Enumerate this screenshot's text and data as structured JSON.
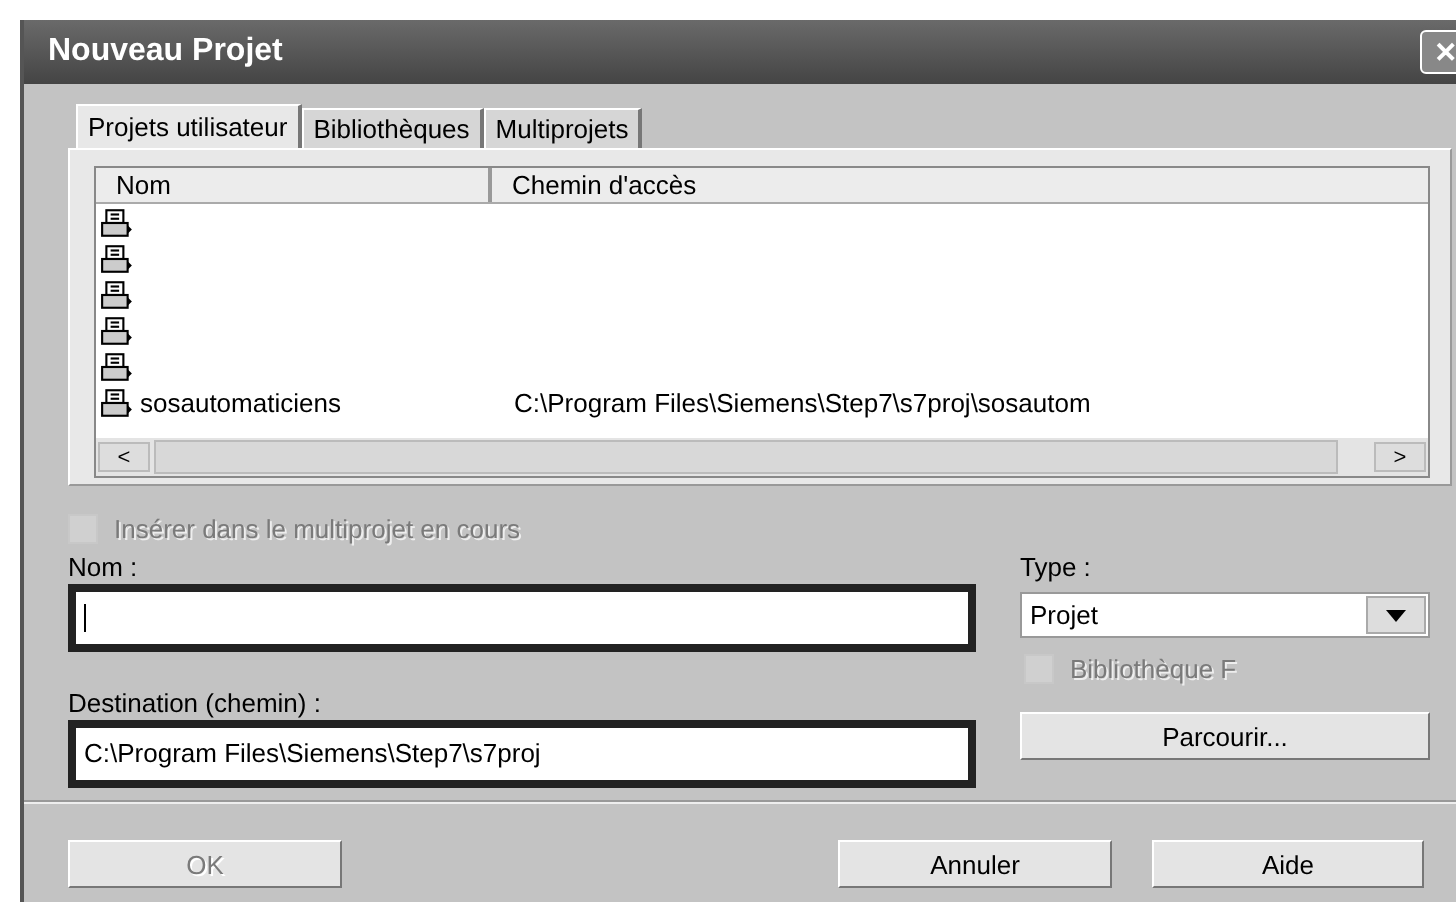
{
  "window": {
    "title": "Nouveau Projet",
    "close": "✕"
  },
  "tabs": [
    {
      "label": "Projets utilisateur",
      "selected": true
    },
    {
      "label": "Bibliothèques",
      "selected": false
    },
    {
      "label": "Multiprojets",
      "selected": false
    }
  ],
  "table": {
    "columns": [
      "Nom",
      "Chemin d'accès"
    ],
    "rows": [
      {},
      {},
      {},
      {},
      {},
      {
        "name": "sosautomaticiens",
        "path": "C:\\Program Files\\Siemens\\Step7\\s7proj\\sosautom"
      }
    ]
  },
  "scroll": {
    "left": "<",
    "right": ">"
  },
  "insert_checkbox": {
    "label": "Insérer dans le multiprojet en cours",
    "checked": false,
    "disabled": true
  },
  "name_field": {
    "label": "Nom :"
  },
  "type_field": {
    "label": "Type :",
    "value": "Projet"
  },
  "library_checkbox": {
    "label": "Bibliothèque F",
    "checked": false,
    "disabled": true
  },
  "destination_field": {
    "label": "Destination (chemin) :",
    "value": "C:\\Program Files\\Siemens\\Step7\\s7proj"
  },
  "browse_button": {
    "label": "Parcourir...",
    "disabled": false
  },
  "buttons": [
    {
      "label": "OK",
      "disabled": true
    },
    {
      "label": "Annuler",
      "disabled": false
    },
    {
      "label": "Aide",
      "disabled": false
    }
  ]
}
